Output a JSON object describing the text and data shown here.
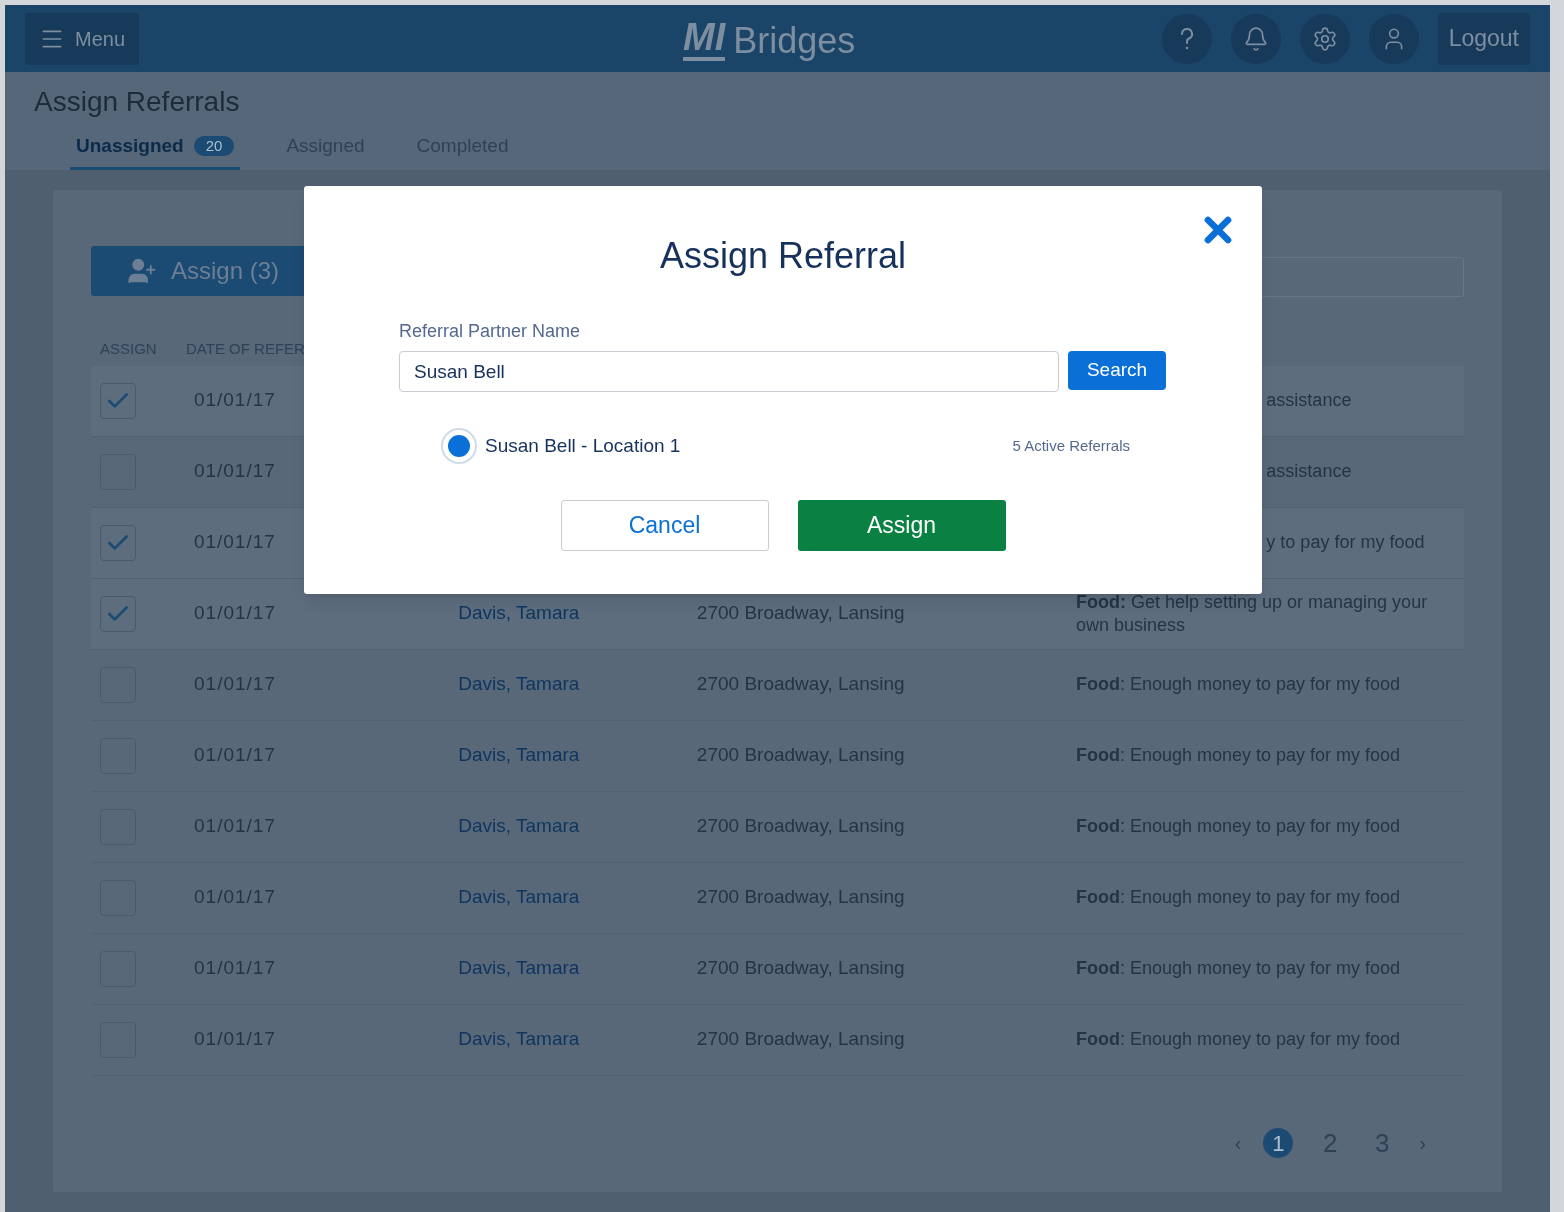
{
  "header": {
    "menu": "Menu",
    "logo_mark": "MI",
    "logo_text": "Bridges",
    "logout": "Logout"
  },
  "page_title": "Assign Referrals",
  "tabs": [
    {
      "label": "Unassigned",
      "badge": "20",
      "selected": true
    },
    {
      "label": "Assigned",
      "selected": false
    },
    {
      "label": "Completed",
      "selected": false
    }
  ],
  "assign_button": "Assign (3)",
  "table": {
    "columns": [
      "ASSIGN",
      "DATE OF REFER"
    ],
    "rows": [
      {
        "checked": true,
        "date": "01/01/17",
        "need": "assistance"
      },
      {
        "checked": false,
        "date": "01/01/17",
        "need": "assistance"
      },
      {
        "checked": true,
        "date": "01/01/17",
        "need": "y to pay for my food"
      },
      {
        "checked": true,
        "date": "01/01/17",
        "name": "Davis, Tamara",
        "address": "2700 Broadway, Lansing",
        "need": "**Food:** Get help setting up or managing your own business"
      },
      {
        "checked": false,
        "date": "01/01/17",
        "name": "Davis, Tamara",
        "address": "2700 Broadway, Lansing",
        "need": "**Food**: Enough money to pay for my food"
      },
      {
        "checked": false,
        "date": "01/01/17",
        "name": "Davis, Tamara",
        "address": "2700 Broadway, Lansing",
        "need": "**Food**: Enough money to pay for my food"
      },
      {
        "checked": false,
        "date": "01/01/17",
        "name": "Davis, Tamara",
        "address": "2700 Broadway, Lansing",
        "need": "**Food**: Enough money to pay for my food"
      },
      {
        "checked": false,
        "date": "01/01/17",
        "name": "Davis, Tamara",
        "address": "2700 Broadway, Lansing",
        "need": "**Food**: Enough money to pay for my food"
      },
      {
        "checked": false,
        "date": "01/01/17",
        "name": "Davis, Tamara",
        "address": "2700 Broadway, Lansing",
        "need": "**Food**: Enough money to pay for my food"
      },
      {
        "checked": false,
        "date": "01/01/17",
        "name": "Davis, Tamara",
        "address": "2700 Broadway, Lansing",
        "need": "**Food**: Enough money to pay for my food"
      }
    ]
  },
  "pagination": {
    "prev": "‹",
    "pages": [
      {
        "label": "1",
        "selected": true
      },
      {
        "label": "2",
        "selected": false
      },
      {
        "label": "3",
        "selected": false
      }
    ],
    "next": "›"
  },
  "modal": {
    "title": "Assign Referral",
    "field_label": "Referral Partner Name",
    "field_value": "Susan Bell",
    "search": "Search",
    "results": [
      {
        "name": "Susan Bell - Location 1",
        "count": "5 Active Referrals",
        "selected": true
      }
    ],
    "cancel": "Cancel",
    "assign": "Assign"
  }
}
